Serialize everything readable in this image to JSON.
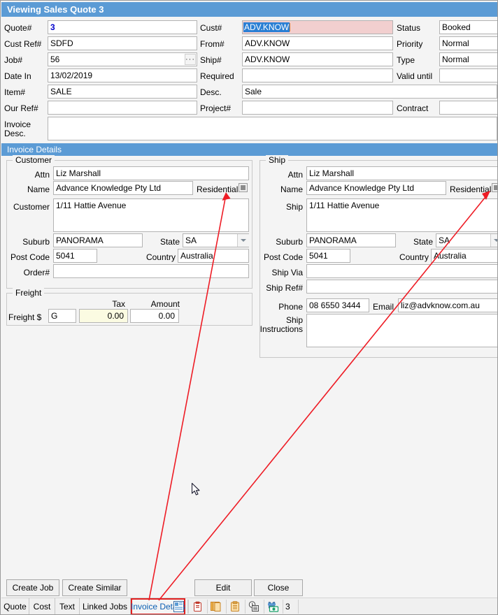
{
  "window": {
    "title": "Viewing Sales Quote 3",
    "accent_color": "#5b9bd5",
    "highlight_color": "#2a7fd4",
    "error_color": "#e02020",
    "link_color": "#0c5fb3"
  },
  "header": {
    "fields": [
      {
        "label": "Quote#",
        "value": "3"
      },
      {
        "label": "Cust Ref#",
        "value": "SDFD"
      },
      {
        "label": "Job#",
        "value": "56"
      },
      {
        "label": "Date In",
        "value": "13/02/2019"
      },
      {
        "label": "Item#",
        "value": "SALE"
      },
      {
        "label": "Our Ref#",
        "value": ""
      },
      {
        "label": "Invoice",
        "label2": "Desc.",
        "value": ""
      }
    ],
    "mid_fields": [
      {
        "label": "Cust#",
        "value": "ADV.KNOW"
      },
      {
        "label": "From#",
        "value": "ADV.KNOW"
      },
      {
        "label": "Ship#",
        "value": "ADV.KNOW"
      },
      {
        "label": "Required",
        "value": ""
      },
      {
        "label": "Desc.",
        "value": "Sale"
      },
      {
        "label": "Project#",
        "value": ""
      }
    ],
    "right_fields": [
      {
        "label": "Status",
        "value": "Booked"
      },
      {
        "label": "Priority",
        "value": "Normal"
      },
      {
        "label": "Type",
        "value": "Normal"
      },
      {
        "label": "Valid until",
        "value": ""
      },
      {
        "label": "Contract",
        "value": ""
      }
    ],
    "ellipsis_label": "···"
  },
  "section": {
    "band_title": "Invoice Details"
  },
  "customer": {
    "caption": "Customer",
    "attn_label": "Attn",
    "attn_value": "Liz Marshall",
    "name_label": "Name",
    "name_value": "Advance Knowledge Pty Ltd",
    "residential_label": "Residential",
    "address_label": "Customer",
    "address_value": "1/11 Hattie Avenue",
    "suburb_label": "Suburb",
    "suburb_value": "PANORAMA",
    "state_label": "State",
    "state_value": "SA",
    "postcode_label": "Post Code",
    "postcode_value": "5041",
    "country_label": "Country",
    "country_value": "Australia",
    "order_label": "Order#",
    "order_value": ""
  },
  "freight": {
    "caption": "Freight",
    "tax_header": "Tax",
    "amount_header": "Amount",
    "row_label": "Freight $",
    "code_value": "G",
    "tax_value": "0.00",
    "amount_value": "0.00"
  },
  "ship": {
    "caption": "Ship",
    "attn_label": "Attn",
    "attn_value": "Liz Marshall",
    "name_label": "Name",
    "name_value": "Advance Knowledge Pty Ltd",
    "residential_label": "Residential",
    "address_label": "Ship",
    "address_value": "1/11 Hattie Avenue",
    "suburb_label": "Suburb",
    "suburb_value": "PANORAMA",
    "state_label": "State",
    "state_value": "SA",
    "postcode_label": "Post Code",
    "postcode_value": "5041",
    "country_label": "Country",
    "country_value": "Australia",
    "shipvia_label": "Ship Via",
    "shipvia_value": "",
    "shipref_label": "Ship Ref#",
    "shipref_value": "",
    "phone_label": "Phone",
    "phone_value": "08 6550 3444",
    "email_label": "Email",
    "email_value": "liz@advknow.com.au",
    "instructions_label": "Ship",
    "instructions_label2": "Instructions",
    "instructions_value": ""
  },
  "footer": {
    "buttons": [
      {
        "name": "create-job",
        "label": "Create Job"
      },
      {
        "name": "create-similar",
        "label": "Create Similar"
      },
      {
        "name": "edit",
        "label": "Edit"
      },
      {
        "name": "close",
        "label": "Close"
      }
    ],
    "tabs": [
      {
        "name": "quote",
        "label": "Quote",
        "active": false
      },
      {
        "name": "cost",
        "label": "Cost",
        "active": false
      },
      {
        "name": "text",
        "label": "Text",
        "active": false
      },
      {
        "name": "linked-jobs",
        "label": "Linked Jobs",
        "active": false
      },
      {
        "name": "invoice-details",
        "label": "Invoice Details",
        "active": true
      }
    ],
    "toolbar_icons": [
      "document-details-icon",
      "clipboard-paste-icon",
      "copy-pages-icon",
      "clipboard-icon",
      "history-icon",
      "money-gift-icon"
    ],
    "attachment_count": "3"
  }
}
